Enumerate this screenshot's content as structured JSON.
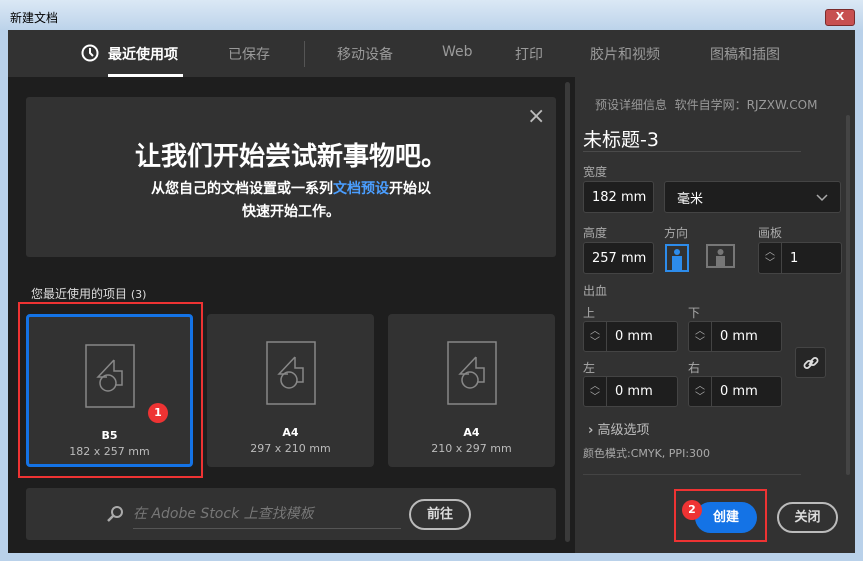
{
  "window": {
    "title": "新建文档",
    "close_label": "X"
  },
  "tabs": [
    {
      "label": "最近使用项",
      "active": true
    },
    {
      "label": "已保存"
    },
    {
      "label": "移动设备"
    },
    {
      "label": "Web"
    },
    {
      "label": "打印"
    },
    {
      "label": "胶片和视频"
    },
    {
      "label": "图稿和插图"
    }
  ],
  "banner": {
    "headline": "让我们开始尝试新事物吧。",
    "line1_pre": "从您自己的文档设置或一系列",
    "line1_link": "文档预设",
    "line1_post": "开始以",
    "line2": "快速开始工作。",
    "close_icon": "×"
  },
  "recent": {
    "label": "您最近使用的项目",
    "count": "(3)",
    "items": [
      {
        "name": "B5",
        "size": "182 x 257 mm"
      },
      {
        "name": "A4",
        "size": "297 x 210 mm"
      },
      {
        "name": "A4",
        "size": "210 x 297 mm"
      }
    ]
  },
  "search": {
    "placeholder": "在 Adobe Stock 上查找模板",
    "go_label": "前往"
  },
  "badges": {
    "one": "1",
    "two": "2"
  },
  "preset": {
    "header": "预设详细信息",
    "watermark": "软件自学网：RJZXW.COM",
    "name": "未标题-3",
    "width_label": "宽度",
    "width": "182 mm",
    "unit": "毫米",
    "height_label": "高度",
    "height": "257 mm",
    "orientation_label": "方向",
    "artboards_label": "画板",
    "artboards": "1",
    "bleed_label": "出血",
    "top_label": "上",
    "top": "0 mm",
    "bottom_label": "下",
    "bottom": "0 mm",
    "left_label": "左",
    "left": "0 mm",
    "right_label": "右",
    "right": "0 mm",
    "advanced_label": "高级选项",
    "color_mode": "颜色模式:CMYK, PPI:300"
  },
  "actions": {
    "create": "创建",
    "close": "关闭"
  },
  "colors": {
    "accent": "#1473e6",
    "highlight": "#ee3333"
  }
}
